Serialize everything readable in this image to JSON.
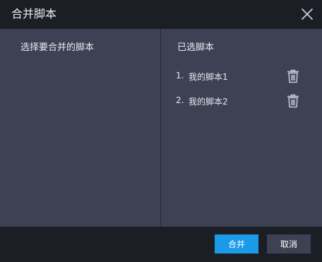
{
  "dialog": {
    "title": "合并脚本",
    "close_icon": "close-icon"
  },
  "left_panel": {
    "title": "选择要合并的脚本"
  },
  "right_panel": {
    "title": "已选脚本",
    "items": [
      {
        "index": "1.",
        "name": "我的脚本1",
        "icon": "trash-icon"
      },
      {
        "index": "2.",
        "name": "我的脚本2",
        "icon": "trash-icon"
      }
    ]
  },
  "footer": {
    "merge_label": "合并",
    "cancel_label": "取消"
  },
  "colors": {
    "background": "#1b1e25",
    "panel": "#3c4254",
    "primary": "#1a9be8"
  }
}
